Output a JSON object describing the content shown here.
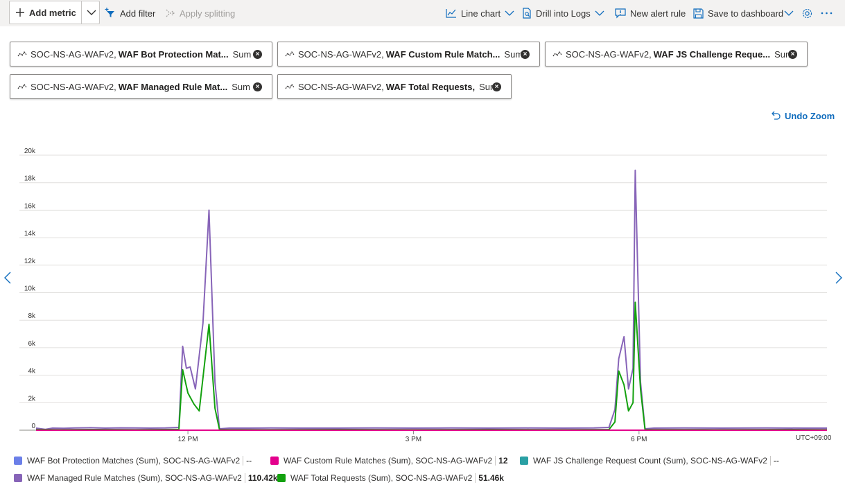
{
  "toolbar": {
    "add_metric": "Add metric",
    "add_filter": "Add filter",
    "apply_splitting": "Apply splitting",
    "line_chart": "Line chart",
    "drill_logs": "Drill into Logs",
    "new_alert": "New alert rule",
    "save_dashboard": "Save to dashboard"
  },
  "pills": [
    {
      "resource": "SOC-NS-AG-WAFv2,",
      "metric": "WAF Bot Protection Mat...",
      "agg": "Sum"
    },
    {
      "resource": "SOC-NS-AG-WAFv2,",
      "metric": "WAF Custom Rule Match...",
      "agg": "Sum"
    },
    {
      "resource": "SOC-NS-AG-WAFv2,",
      "metric": "WAF JS Challenge Reque...",
      "agg": "Sum"
    },
    {
      "resource": "SOC-NS-AG-WAFv2,",
      "metric": "WAF Managed Rule Mat...",
      "agg": "Sum"
    },
    {
      "resource": "SOC-NS-AG-WAFv2,",
      "metric": "WAF Total Requests,",
      "agg": "Sum"
    }
  ],
  "undo_zoom": "Undo Zoom",
  "timezone": "UTC+09:00",
  "legend": [
    {
      "label": "WAF Bot Protection Matches (Sum), SOC-NS-AG-WAFv2",
      "value": "--",
      "color": "#6b7fe8"
    },
    {
      "label": "WAF Custom Rule Matches (Sum), SOC-NS-AG-WAFv2",
      "value": "12",
      "color": "#e3008c"
    },
    {
      "label": "WAF JS Challenge Request Count (Sum), SOC-NS-AG-WAFv2",
      "value": "--",
      "color": "#2aa0a4"
    },
    {
      "label": "WAF Managed Rule Matches (Sum), SOC-NS-AG-WAFv2",
      "value": "110.42k",
      "color": "#8764b8"
    },
    {
      "label": "WAF Total Requests (Sum), SOC-NS-AG-WAFv2",
      "value": "51.46k",
      "color": "#13a10e"
    }
  ],
  "chart_data": {
    "type": "line",
    "y_ticks": [
      "0",
      "2k",
      "4k",
      "6k",
      "8k",
      "10k",
      "12k",
      "14k",
      "16k",
      "18k",
      "20k"
    ],
    "x_ticks": [
      "12 PM",
      "3 PM",
      "6 PM"
    ],
    "ylim": [
      0,
      20000
    ],
    "grid": true,
    "series": [
      {
        "name": "WAF Managed Rule Matches (Sum), SOC-NS-AG-WAFv2",
        "color": "#8764b8",
        "points": [
          [
            9.98,
            150
          ],
          [
            10.1,
            60
          ],
          [
            10.2,
            150
          ],
          [
            10.35,
            140
          ],
          [
            10.5,
            160
          ],
          [
            10.7,
            180
          ],
          [
            10.9,
            150
          ],
          [
            11.1,
            170
          ],
          [
            11.3,
            160
          ],
          [
            11.5,
            150
          ],
          [
            11.7,
            160
          ],
          [
            11.88,
            200
          ],
          [
            11.93,
            6100
          ],
          [
            11.98,
            4500
          ],
          [
            12.03,
            4600
          ],
          [
            12.1,
            3000
          ],
          [
            12.2,
            7800
          ],
          [
            12.28,
            16000
          ],
          [
            12.36,
            3500
          ],
          [
            12.42,
            100
          ],
          [
            12.55,
            150
          ],
          [
            12.8,
            150
          ],
          [
            13.1,
            160
          ],
          [
            13.5,
            150
          ],
          [
            14,
            150
          ],
          [
            14.5,
            160
          ],
          [
            15,
            150
          ],
          [
            15.5,
            160
          ],
          [
            16,
            150
          ],
          [
            16.5,
            160
          ],
          [
            17,
            150
          ],
          [
            17.4,
            160
          ],
          [
            17.6,
            200
          ],
          [
            17.68,
            1500
          ],
          [
            17.73,
            5200
          ],
          [
            17.8,
            6800
          ],
          [
            17.86,
            3000
          ],
          [
            17.92,
            4500
          ],
          [
            17.95,
            18900
          ],
          [
            18.02,
            3500
          ],
          [
            18.08,
            100
          ],
          [
            18.2,
            150
          ],
          [
            18.6,
            160
          ],
          [
            19.1,
            150
          ],
          [
            19.7,
            160
          ],
          [
            20.2,
            150
          ],
          [
            20.5,
            150
          ]
        ]
      },
      {
        "name": "WAF Total Requests (Sum), SOC-NS-AG-WAFv2",
        "color": "#13a10e",
        "points": [
          [
            9.98,
            50
          ],
          [
            10.3,
            40
          ],
          [
            10.8,
            50
          ],
          [
            11.3,
            40
          ],
          [
            11.88,
            60
          ],
          [
            11.93,
            4400
          ],
          [
            12.0,
            2700
          ],
          [
            12.08,
            1900
          ],
          [
            12.15,
            1400
          ],
          [
            12.28,
            7700
          ],
          [
            12.36,
            1600
          ],
          [
            12.42,
            50
          ],
          [
            13,
            40
          ],
          [
            14,
            50
          ],
          [
            15,
            40
          ],
          [
            16,
            50
          ],
          [
            17,
            40
          ],
          [
            17.6,
            50
          ],
          [
            17.68,
            600
          ],
          [
            17.73,
            4300
          ],
          [
            17.8,
            3300
          ],
          [
            17.86,
            1400
          ],
          [
            17.92,
            2000
          ],
          [
            17.95,
            9300
          ],
          [
            18.02,
            3000
          ],
          [
            18.08,
            50
          ],
          [
            19,
            40
          ],
          [
            20,
            50
          ],
          [
            20.5,
            40
          ]
        ]
      },
      {
        "name": "WAF Custom Rule Matches (Sum), SOC-NS-AG-WAFv2",
        "color": "#e3008c",
        "points": [
          [
            9.98,
            0
          ],
          [
            20.5,
            0
          ]
        ]
      }
    ]
  }
}
